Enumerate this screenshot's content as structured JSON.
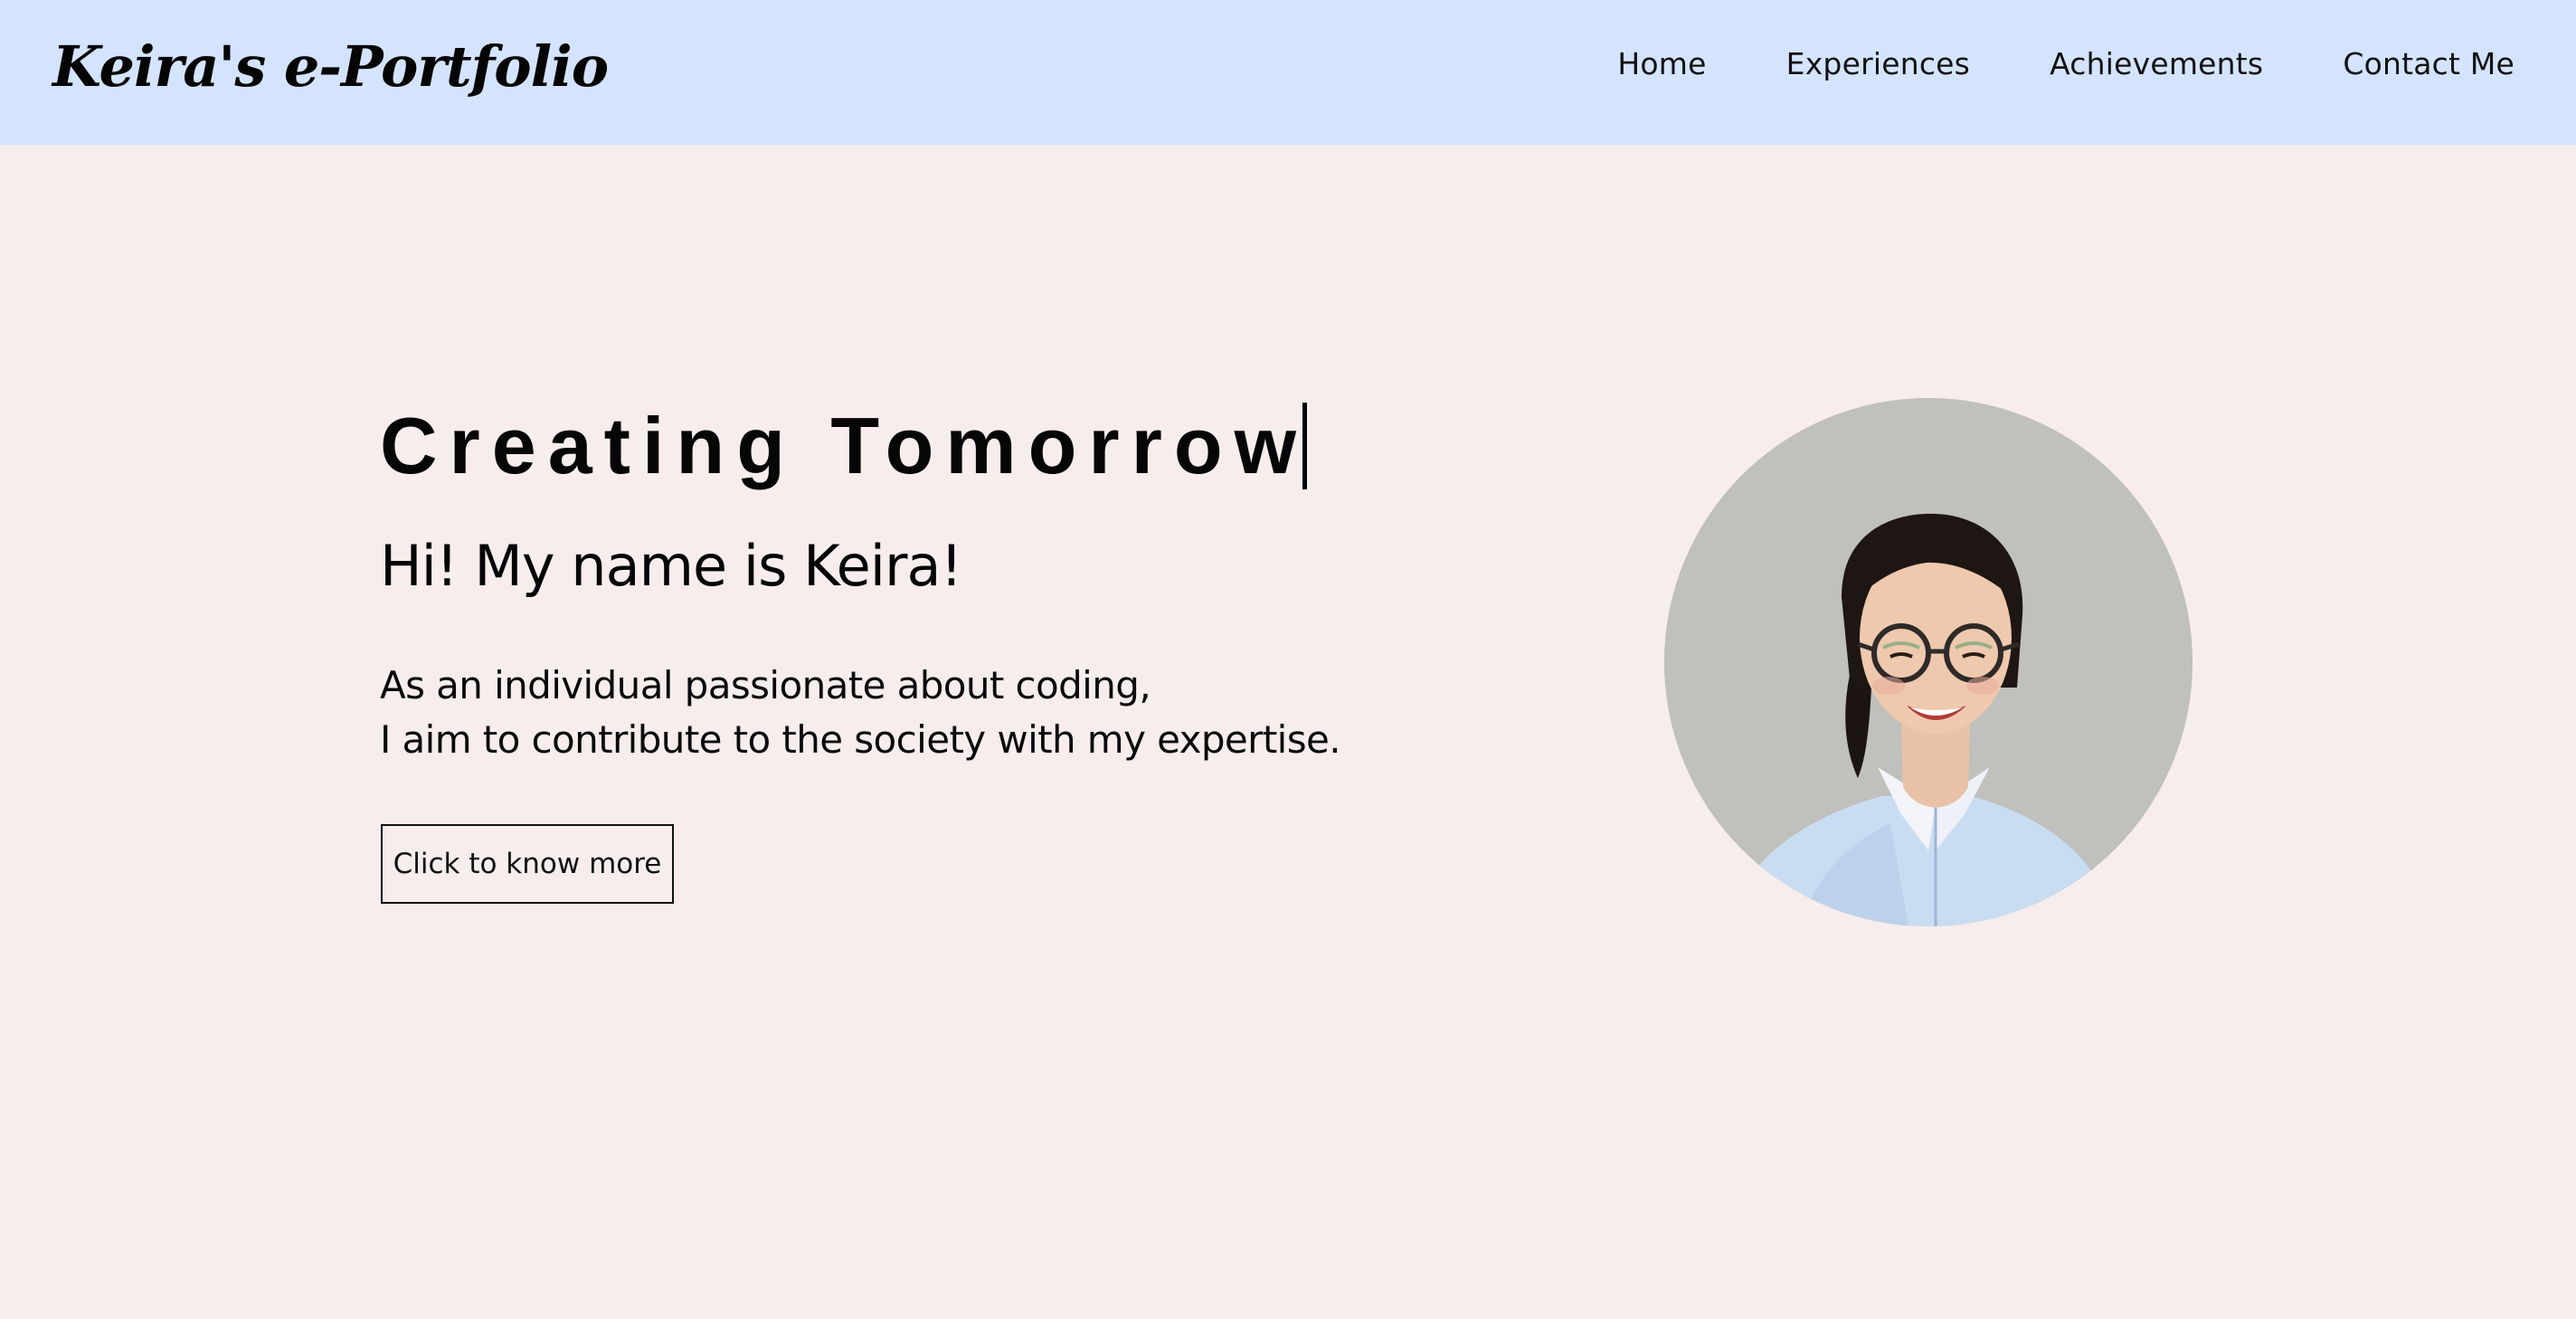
{
  "header": {
    "brand": "Keira's e-Portfolio",
    "nav": [
      {
        "label": "Home"
      },
      {
        "label": "Experiences"
      },
      {
        "label": "Achievements"
      },
      {
        "label": "Contact Me"
      }
    ]
  },
  "hero": {
    "headline": "Creating Tomorrow",
    "greeting": "Hi! My name is Keira!",
    "intro_line_1": "As an individual passionate about coding,",
    "intro_line_2": "I aim to contribute to the society with my expertise.",
    "cta_label": "Click to know more"
  },
  "profile_photo": {
    "icon": "profile-photo"
  },
  "colors": {
    "header_bg": "#d4e4ff",
    "page_bg": "#f7eded",
    "text": "#000000",
    "photo_bg": "#c5c5c2",
    "shirt": "#c9ddf2"
  }
}
